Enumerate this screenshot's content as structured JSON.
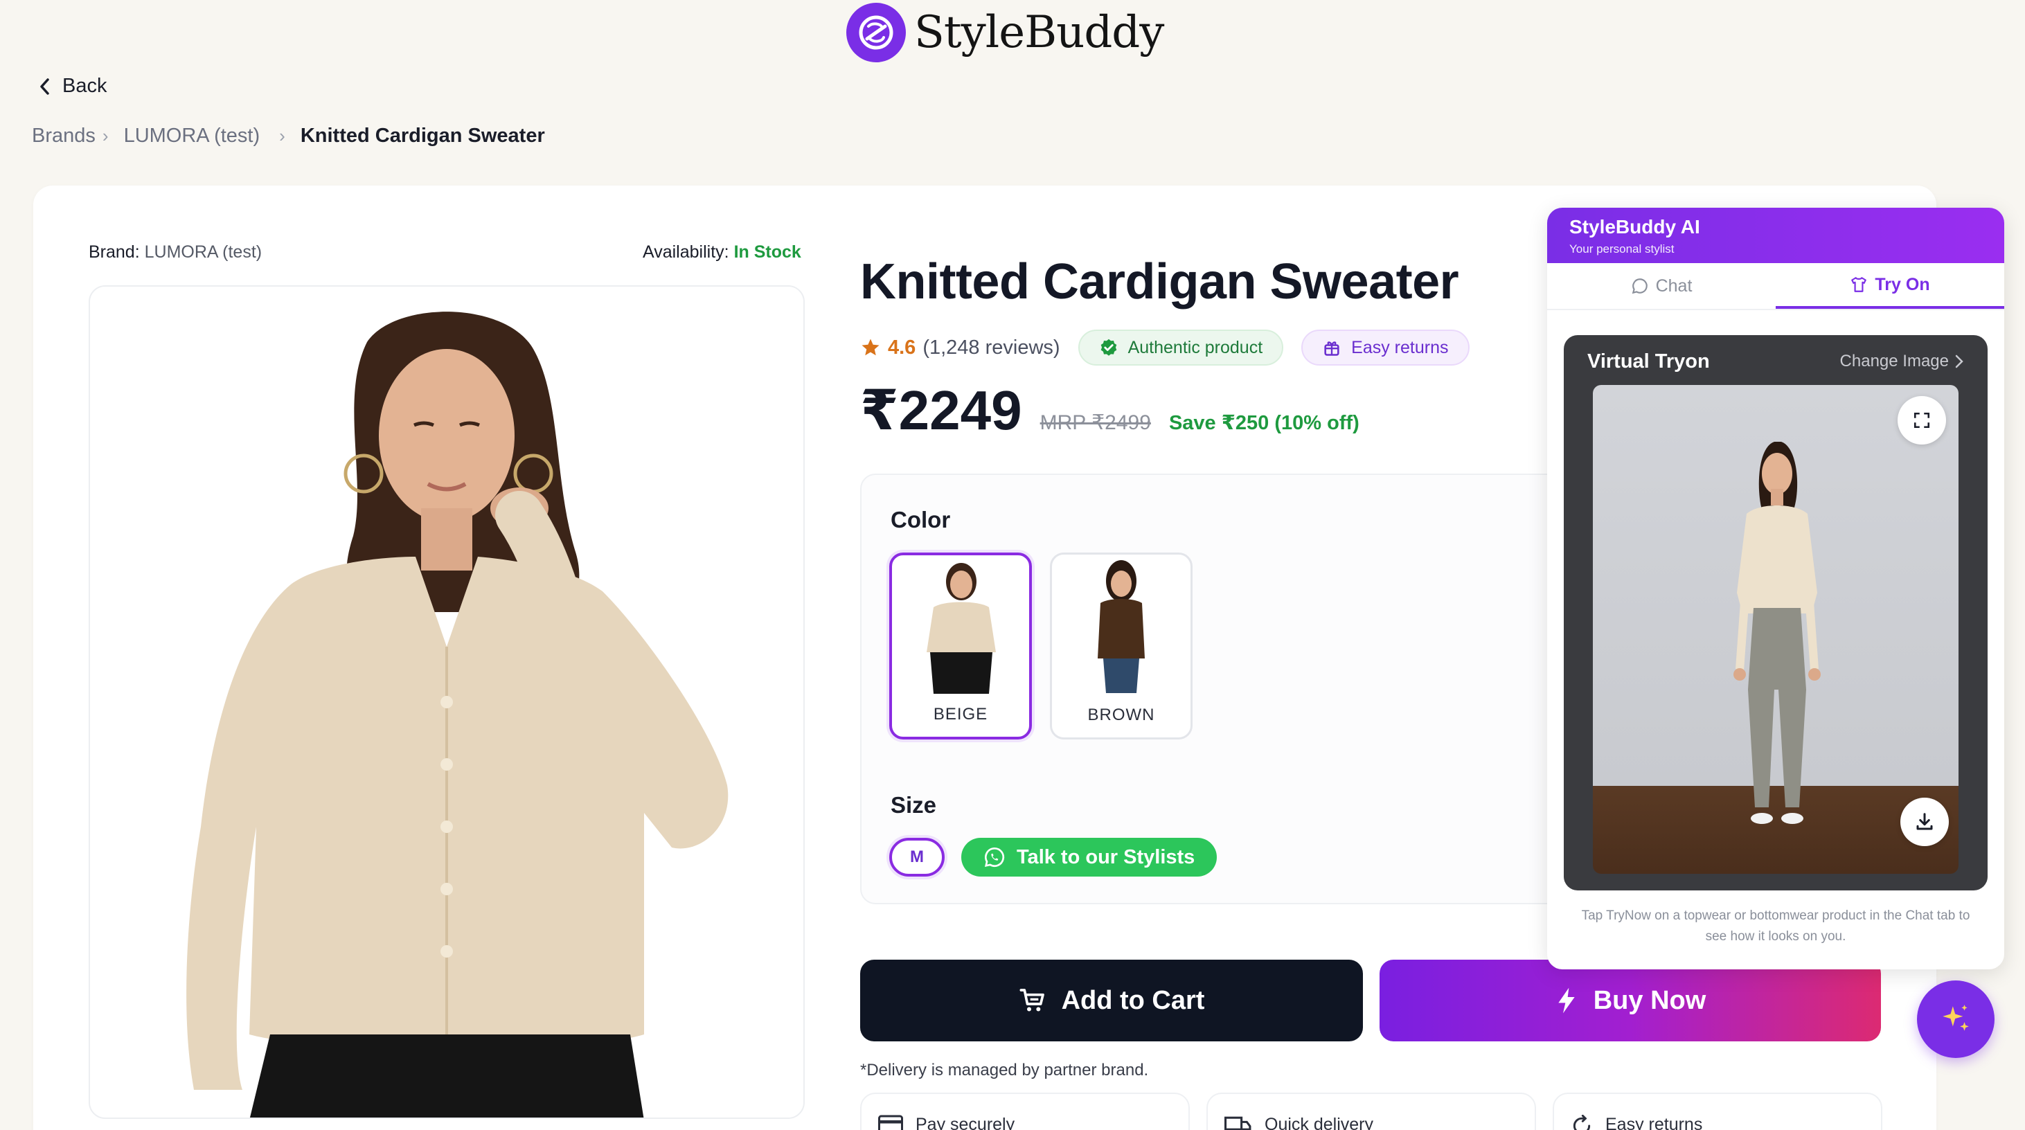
{
  "app": {
    "name": "StyleBuddy"
  },
  "nav": {
    "back_label": "Back"
  },
  "breadcrumb": {
    "items": [
      {
        "label": "Brands"
      },
      {
        "label": "LUMORA (test)"
      },
      {
        "label": "Knitted Cardigan Sweater"
      }
    ]
  },
  "product": {
    "brand_label": "Brand:",
    "brand_value": "LUMORA (test)",
    "availability_label": "Availability:",
    "availability_value": "In Stock",
    "title": "Knitted Cardigan Sweater",
    "rating": "4.6",
    "reviews": "(1,248 reviews)",
    "badge_authentic": "Authentic product",
    "badge_returns": "Easy returns",
    "price": "₹2249",
    "mrp": "MRP ₹2499",
    "savings": "Save ₹250 (10% off)"
  },
  "options": {
    "color_heading": "Color",
    "colors": [
      {
        "name": "BEIGE",
        "selected": true
      },
      {
        "name": "BROWN",
        "selected": false
      }
    ],
    "size_heading": "Size",
    "sizes": [
      {
        "name": "M",
        "selected": true
      }
    ],
    "stylist_button": "Talk to our Stylists"
  },
  "actions": {
    "add_to_cart": "Add to Cart",
    "buy_now": "Buy Now",
    "delivery_note": "*Delivery is managed by partner brand."
  },
  "features": [
    {
      "label": "Pay securely",
      "icon": "card-icon"
    },
    {
      "label": "Quick delivery",
      "icon": "truck-icon"
    },
    {
      "label": "Easy returns",
      "icon": "return-icon"
    }
  ],
  "ai_panel": {
    "title": "StyleBuddy AI",
    "subtitle": "Your personal stylist",
    "tabs": [
      {
        "label": "Chat",
        "active": false
      },
      {
        "label": "Try On",
        "active": true
      }
    ],
    "tryon_title": "Virtual Tryon",
    "change_image": "Change Image",
    "hint": "Tap TryNow on a topwear or bottomwear product in the Chat tab to see how it looks on you."
  },
  "colors": {
    "accent": "#7a2ee6",
    "success": "#1e9a3f",
    "dark_button": "#0f1523",
    "whatsapp": "#2cc65b",
    "rating": "#d9731a"
  }
}
